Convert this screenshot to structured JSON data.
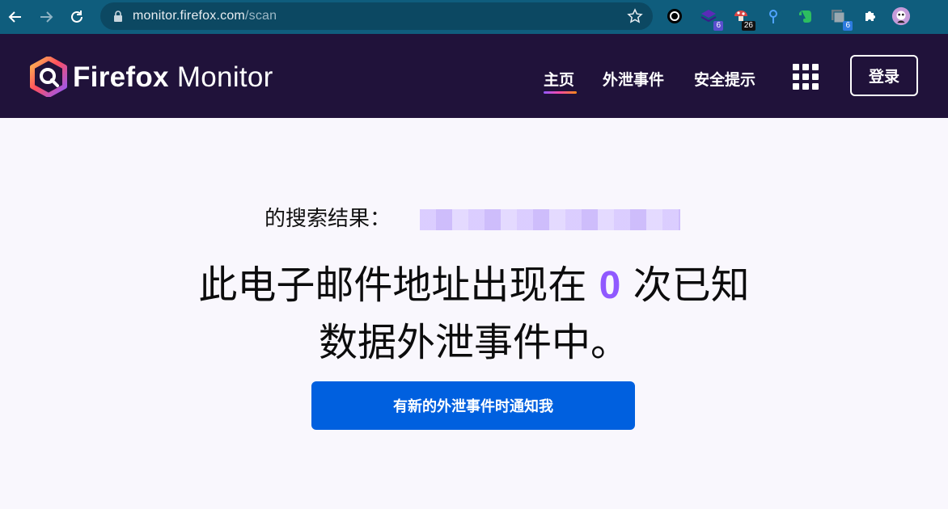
{
  "browser": {
    "url_host": "monitor.firefox.com",
    "url_path": "/scan",
    "extensions": [
      {
        "name": "circle-extension-icon",
        "badge": ""
      },
      {
        "name": "stack-extension-icon",
        "badge": "6"
      },
      {
        "name": "mushroom-extension-icon",
        "badge": "26"
      },
      {
        "name": "pin-extension-icon",
        "badge": ""
      },
      {
        "name": "evernote-extension-icon",
        "badge": ""
      },
      {
        "name": "tabs-extension-icon",
        "badge": "6"
      }
    ]
  },
  "header": {
    "brand_bold": "Firefox",
    "brand_light": "Monitor",
    "nav": [
      "主页",
      "外泄事件",
      "安全提示"
    ],
    "login": "登录"
  },
  "main": {
    "search_label": "的搜索结果：",
    "headline_pre": "此电子邮件地址出现在",
    "count": "0",
    "headline_post": "次已知",
    "headline_line2": "数据外泄事件中。",
    "cta": "有新的外泄事件时通知我"
  },
  "colors": {
    "chrome": "#0f5d7d",
    "header_bg": "#20123a",
    "accent_purple": "#9059ff",
    "cta_blue": "#0060df"
  }
}
